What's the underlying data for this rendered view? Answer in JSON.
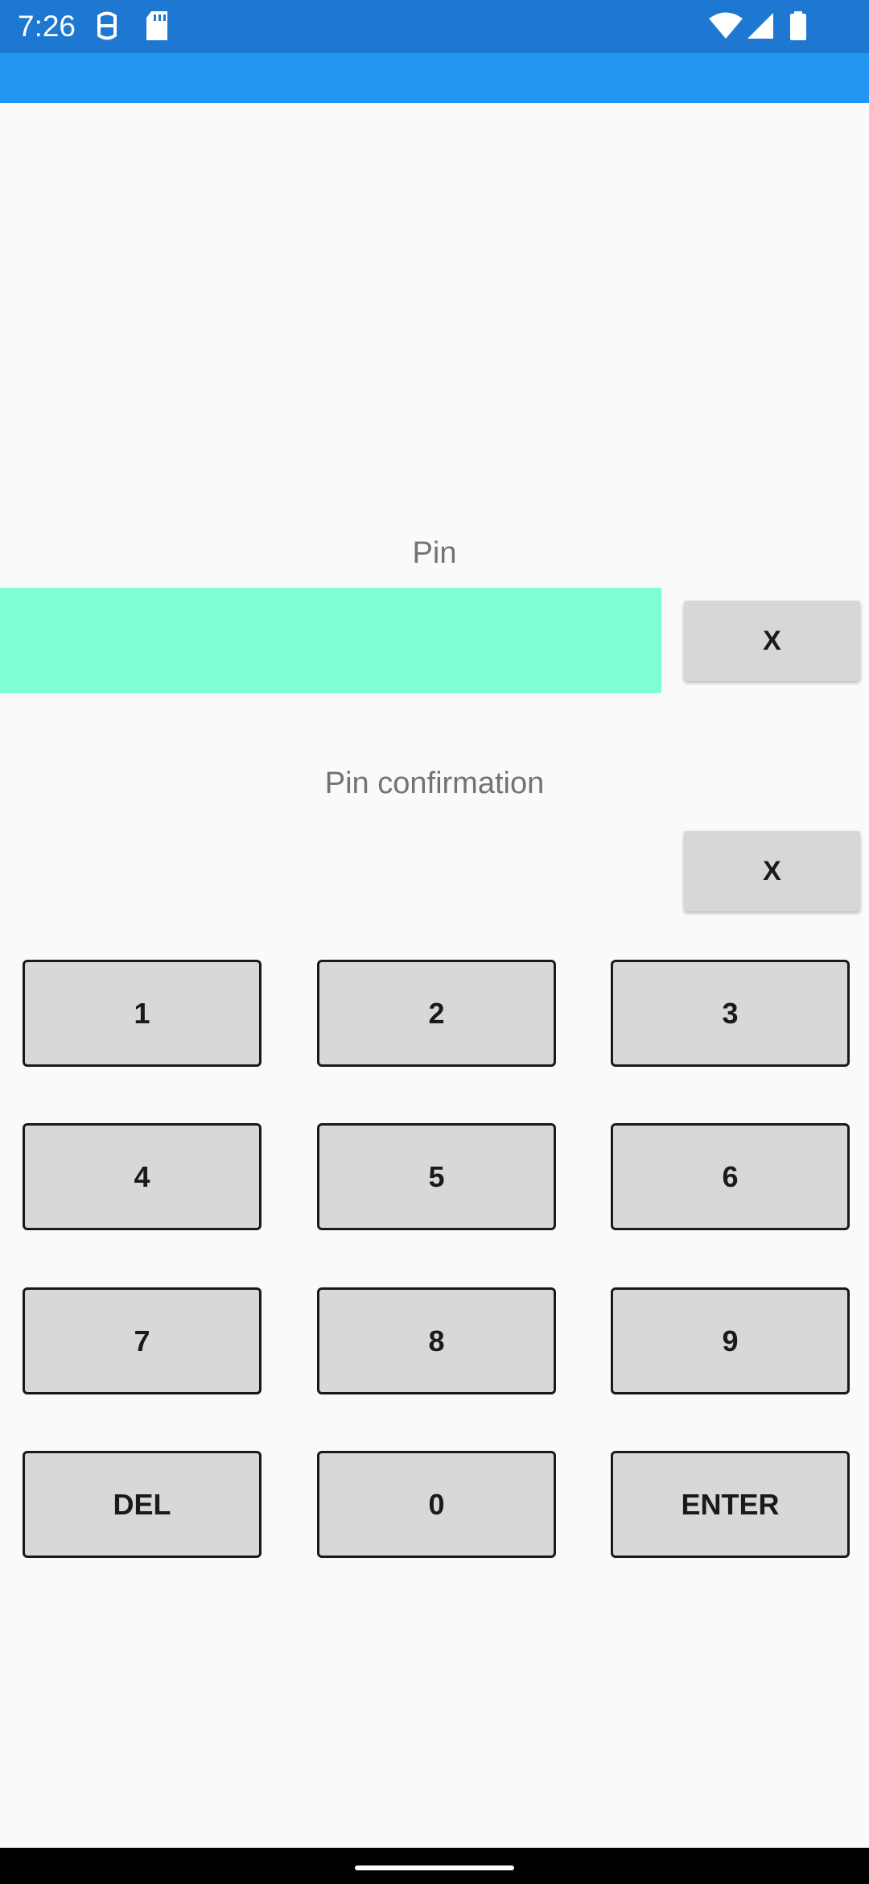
{
  "status_bar": {
    "time": "7:26",
    "left_icons": [
      "face-unlock-icon",
      "sd-card-icon"
    ],
    "right_icons": [
      "wifi-icon",
      "cell-signal-icon",
      "battery-icon"
    ],
    "background_color": "#1e78d2"
  },
  "app_bar": {
    "background_color": "#2196f3"
  },
  "pin": {
    "label": "Pin",
    "value": "",
    "clear_label": "X",
    "highlight_color": "#80ffd6"
  },
  "pin_confirmation": {
    "label": "Pin confirmation",
    "value": "",
    "clear_label": "X"
  },
  "keypad": {
    "keys": [
      "1",
      "2",
      "3",
      "4",
      "5",
      "6",
      "7",
      "8",
      "9",
      "DEL",
      "0",
      "ENTER"
    ]
  }
}
